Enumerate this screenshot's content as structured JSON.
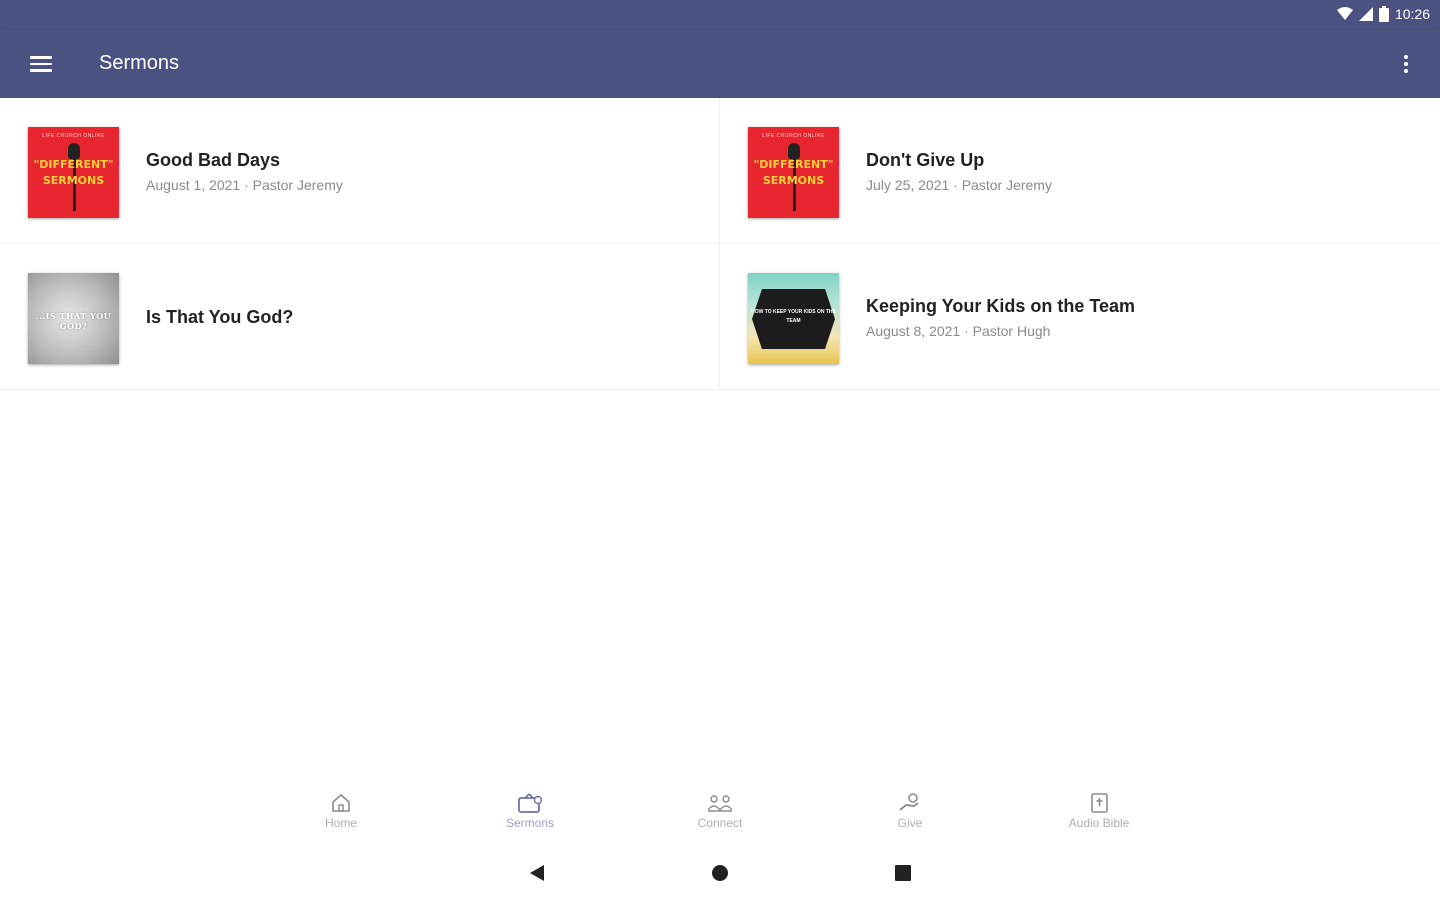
{
  "status_bar": {
    "time": "10:26"
  },
  "app_bar": {
    "title": "Sermons"
  },
  "sermons": [
    {
      "title": "Good Bad Days",
      "meta": "August 1, 2021 · Pastor Jeremy",
      "art": "different-sermons"
    },
    {
      "title": "Don't Give Up",
      "meta": "July 25, 2021 · Pastor Jeremy",
      "art": "different-sermons"
    },
    {
      "title": "Is That You God?",
      "meta": "",
      "art": "is-that-you-god"
    },
    {
      "title": "Keeping Your Kids on the Team",
      "meta": "August 8, 2021 · Pastor Hugh",
      "art": "keeping-kids"
    }
  ],
  "artwork": {
    "different_top": "LIFE CHURCH ONLINE",
    "different_line1": "\"DIFFERENT\"",
    "different_line2": "SERMONS",
    "grey_text": "...IS THAT YOU GOD?",
    "teal_text": "HOW TO KEEP YOUR KIDS ON THE TEAM"
  },
  "bottom_nav": [
    {
      "label": "Home",
      "icon": "home-icon",
      "active": false
    },
    {
      "label": "Sermons",
      "icon": "tv-icon",
      "active": true
    },
    {
      "label": "Connect",
      "icon": "group-icon",
      "active": false
    },
    {
      "label": "Give",
      "icon": "give-hand-icon",
      "active": false
    },
    {
      "label": "Audio Bible",
      "icon": "bible-icon",
      "active": false
    }
  ],
  "colors": {
    "primary": "#4b5180",
    "accent_red": "#e8262f",
    "accent_yellow": "#f8d339"
  }
}
